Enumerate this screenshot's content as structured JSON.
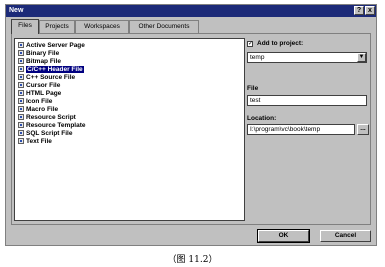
{
  "window": {
    "title": "New",
    "help_label": "?",
    "close_label": "x"
  },
  "tabs": [
    {
      "label": "Files"
    },
    {
      "label": "Projects"
    },
    {
      "label": "Workspaces"
    },
    {
      "label": "Other Documents"
    }
  ],
  "file_types": [
    {
      "label": "Active Server Page"
    },
    {
      "label": "Binary File"
    },
    {
      "label": "Bitmap File"
    },
    {
      "label": "C/C++ Header File"
    },
    {
      "label": "C++ Source File"
    },
    {
      "label": "Cursor File"
    },
    {
      "label": "HTML Page"
    },
    {
      "label": "Icon File"
    },
    {
      "label": "Macro File"
    },
    {
      "label": "Resource Script"
    },
    {
      "label": "Resource Template"
    },
    {
      "label": "SQL Script File"
    },
    {
      "label": "Text File"
    }
  ],
  "selected_file_type": "C/C++ Header File",
  "add_to_project": {
    "label": "Add to project:",
    "checked": true,
    "check_mark": "✓",
    "value": "temp"
  },
  "file_name": {
    "label": "File",
    "value": "test"
  },
  "location": {
    "label": "Location:",
    "value": "I:\\program\\vc\\book\\temp",
    "browse_label": "..."
  },
  "buttons": {
    "ok": "OK",
    "cancel": "Cancel"
  },
  "caption": "（图 11.2）",
  "colors": {
    "titlebar": "#1c2a78",
    "selection": "#000080",
    "dialog_bg": "#c0c0c0"
  }
}
